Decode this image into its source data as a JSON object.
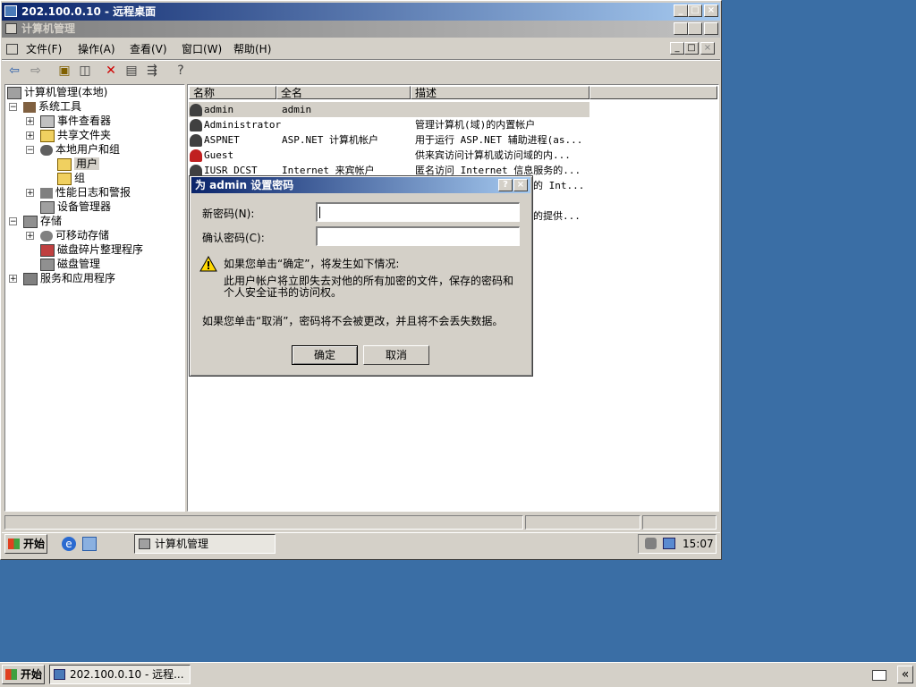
{
  "remote_window": {
    "title": "202.100.0.10 - 远程桌面",
    "minimize": "_",
    "maximize": "□",
    "close": "×"
  },
  "mmc": {
    "title": "计算机管理",
    "menu": [
      "文件(F)",
      "操作(A)",
      "查看(V)",
      "窗口(W)",
      "帮助(H)"
    ],
    "tree": {
      "root": "计算机管理(本地)",
      "system_tools": "系统工具",
      "event_viewer": "事件查看器",
      "shared_folders": "共享文件夹",
      "local_users": "本地用户和组",
      "users": "用户",
      "groups": "组",
      "perf_logs": "性能日志和警报",
      "device_manager": "设备管理器",
      "storage": "存储",
      "removable_storage": "可移动存储",
      "defrag": "磁盘碎片整理程序",
      "disk_mgmt": "磁盘管理",
      "services_apps": "服务和应用程序"
    },
    "columns": [
      "名称",
      "全名",
      "描述"
    ],
    "users": [
      {
        "name": "admin",
        "full": "admin",
        "desc": ""
      },
      {
        "name": "Administrator",
        "full": "",
        "desc": "管理计算机(域)的内置帐户"
      },
      {
        "name": "ASPNET",
        "full": "ASP.NET 计算机帐户",
        "desc": "用于运行 ASP.NET 辅助进程(as..."
      },
      {
        "name": "Guest",
        "full": "",
        "desc": "供来宾访问计算机或访问域的内..."
      },
      {
        "name": "IUSR_DCST",
        "full": "Internet 来宾帐户",
        "desc": "匿名访问 Internet 信息服务的..."
      }
    ],
    "hidden_desc": [
      "的 Int...",
      "的提供..."
    ]
  },
  "dialog": {
    "title": "为 admin 设置密码",
    "help": "?",
    "close": "×",
    "new_pwd_label": "新密码(N):",
    "confirm_pwd_label": "确认密码(C):",
    "warning_line1": "如果您单击“确定”，将发生如下情况:",
    "warning_line2": "此用户帐户将立即失去对他的所有加密的文件，保存的密码和",
    "warning_line3": "个人安全证书的访问权。",
    "cancel_note": "如果您单击“取消”，密码将不会被更改，并且将不会丢失数据。",
    "ok": "确定",
    "cancel": "取消"
  },
  "inner_taskbar": {
    "start": "开始",
    "task": "计算机管理",
    "time": "15:07"
  },
  "host_taskbar": {
    "start": "开始",
    "task": "202.100.0.10 - 远程...",
    "chevron": "«"
  },
  "colors": {
    "desktop": "#3a6ea5",
    "title_active": "#0a246a",
    "title_inactive": "#808080",
    "selection": "#d4d0c8"
  }
}
